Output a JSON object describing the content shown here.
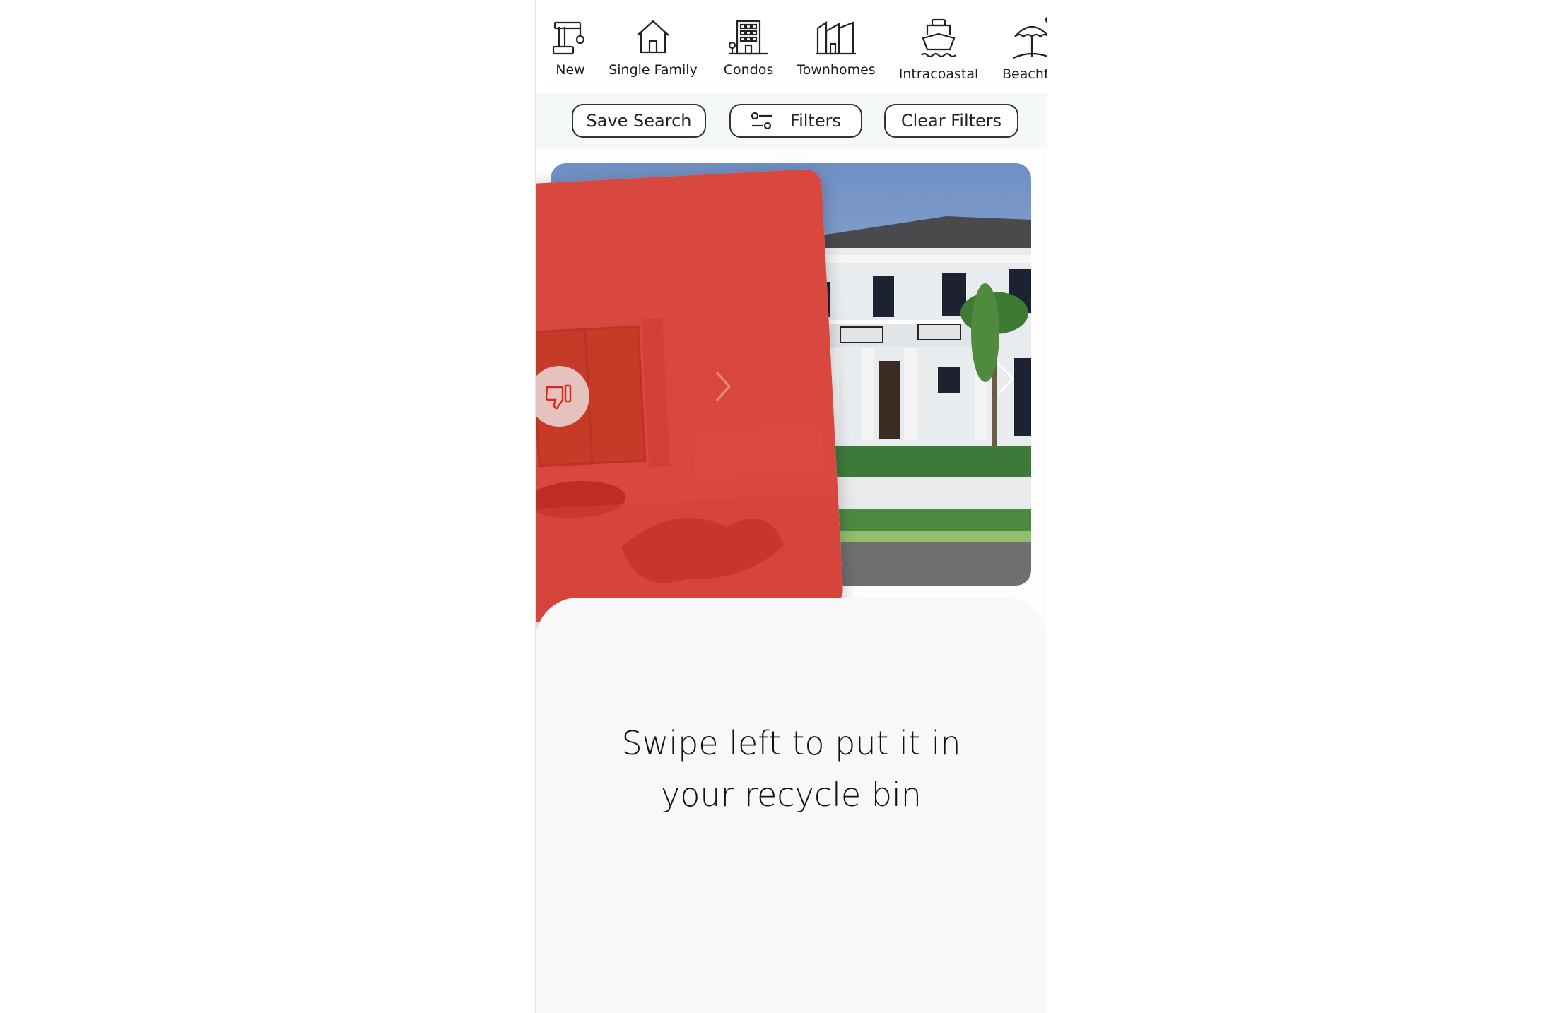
{
  "categories": [
    {
      "label": "New",
      "icon": "crane-icon"
    },
    {
      "label": "Single Family",
      "icon": "house-icon"
    },
    {
      "label": "Condos",
      "icon": "building-icon"
    },
    {
      "label": "Townhomes",
      "icon": "townhomes-icon"
    },
    {
      "label": "Intracoastal",
      "icon": "boat-icon"
    },
    {
      "label": "Beachfr",
      "icon": "beach-umbrella-icon"
    }
  ],
  "actions": {
    "save_search": "Save Search",
    "filters": "Filters",
    "clear_filters": "Clear Filters"
  },
  "card": {
    "overlay_color": "#d42a1f",
    "action_icon": "thumbs-down-icon"
  },
  "onboarding": {
    "line1": "Swipe left to put it in",
    "line2": "your recycle bin"
  }
}
